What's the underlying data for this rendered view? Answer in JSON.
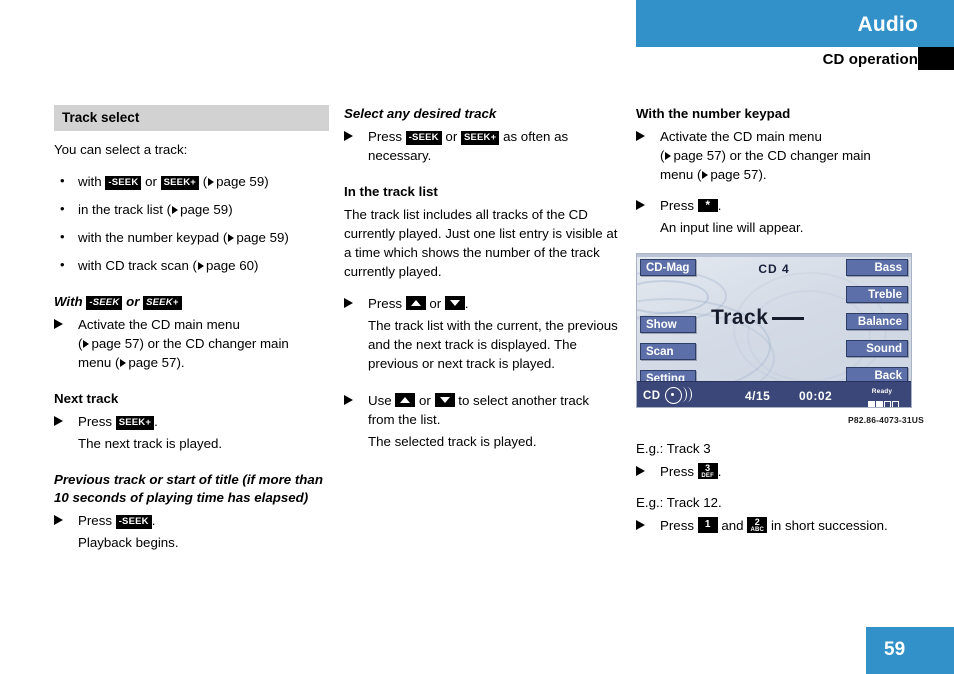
{
  "header": {
    "title": "Audio",
    "subtitle": "CD operation",
    "accent_color": "#3191c8"
  },
  "footer": {
    "page_number": "59"
  },
  "col1": {
    "section_band": "Track select",
    "intro": "You can select a track:",
    "bullets": [
      {
        "pre": "with ",
        "key1": "-SEEK",
        "mid": " or ",
        "key2": "SEEK+",
        "post": " (",
        "ref": "page 59",
        "end": ")"
      },
      {
        "pre": "in the track list (",
        "ref": "page 59",
        "end": ")"
      },
      {
        "pre": "with the number keypad (",
        "ref": "page 59",
        "end": ")"
      },
      {
        "pre": "with CD track scan (",
        "ref": "page 60",
        "end": ")"
      }
    ],
    "h_with_seek_pre": "With ",
    "h_with_seek_key1": "-SEEK",
    "h_with_seek_mid": " or ",
    "h_with_seek_key2": "SEEK+",
    "step_activate_l1": "Activate the CD main menu",
    "step_activate_l2_pre": "(",
    "step_activate_l2_ref": "page 57",
    "step_activate_l2_mid": ") or the CD changer main",
    "step_activate_l3_pre": "menu (",
    "step_activate_l3_ref": "page 57",
    "step_activate_l3_end": ").",
    "h_next_track": "Next track",
    "step_press_pre": "Press ",
    "step_press_key": "SEEK+",
    "step_press_end": ".",
    "result_next": "The next track is played.",
    "h_prev_track": "Previous track or start of title (if more than 10 seconds of playing time has elapsed)",
    "step_press_prev_pre": "Press ",
    "step_press_prev_key": "-SEEK",
    "step_press_prev_end": ".",
    "result_prev": "Playback begins."
  },
  "col2": {
    "h_select_any": "Select any desired track",
    "step_press_pre": "Press ",
    "step_press_key1": "-SEEK",
    "step_press_mid": " or ",
    "step_press_key2": "SEEK+",
    "step_press_post": " as often as necessary.",
    "h_in_track_list": "In the track list",
    "para_track_list": "The track list includes all tracks of the CD currently played. Just one list entry is visible at a time which shows the number of the track currently played.",
    "step_press_arrows_pre": "Press ",
    "step_press_arrows_mid": " or ",
    "step_press_arrows_end": ".",
    "result_track_list": "The track list with the current, the previous and the next track is displayed. The previous or next track is played.",
    "step_use_pre": "Use ",
    "step_use_mid": " or ",
    "step_use_post": " to select another track from the list.",
    "result_selected": "The selected track is played."
  },
  "col3": {
    "h_number_keypad": "With the number keypad",
    "step_activate_l1": "Activate the CD main menu",
    "step_activate_l2_pre": "(",
    "step_activate_l2_ref": "page 57",
    "step_activate_l2_mid": ") or the CD changer main",
    "step_activate_l3_pre": "menu (",
    "step_activate_l3_ref": "page 57",
    "step_activate_l3_end": ").",
    "step_press_star_pre": "Press ",
    "step_press_star_key": "*",
    "step_press_star_end": ".",
    "result_input_line": "An input line will appear.",
    "figure_caption": "P82.86-4073-31US",
    "eg_track3": "E.g.: Track 3",
    "step_press_3_pre": "Press ",
    "step_press_3_digit": "3",
    "step_press_3_letters": "DEF",
    "step_press_3_end": ".",
    "eg_track12": "E.g.: Track 12.",
    "step_press_12_pre": "Press ",
    "step_press_12_digit1": "1",
    "step_press_12_mid": " and ",
    "step_press_12_digit2": "2",
    "step_press_12_letters2": "ABC",
    "step_press_12_post": " in short succession."
  },
  "display": {
    "cd_label": "CD  4",
    "track_label": "Track",
    "buttons_left": [
      "CD-Mag",
      "Show",
      "Scan",
      "Setting"
    ],
    "buttons_right": [
      "Bass",
      "Treble",
      "Balance",
      "Sound",
      "Back"
    ],
    "status": {
      "source": "CD",
      "track_counter": "4/15",
      "elapsed": "00:02",
      "ready_label": "Ready"
    },
    "colors": {
      "button": "#5c6fa8",
      "statusbar": "#3b4778",
      "screen_bg": "#d8dde6"
    }
  }
}
